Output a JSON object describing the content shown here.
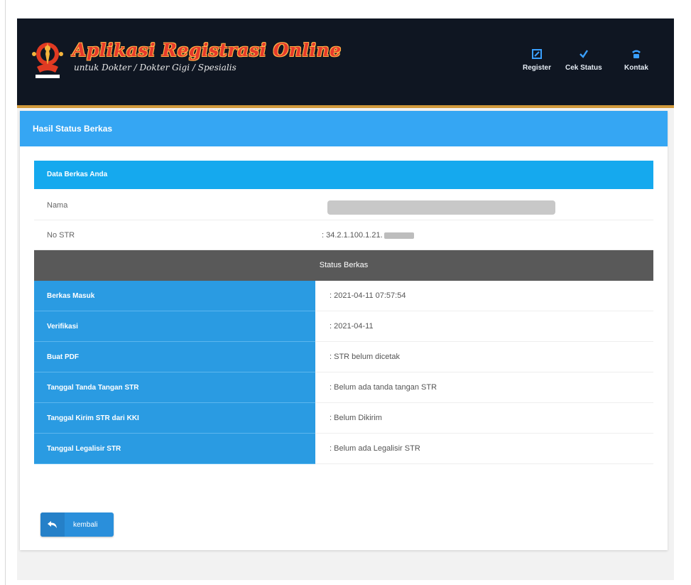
{
  "header": {
    "title": "Aplikasi Registrasi Online",
    "subtitle": "untuk Dokter / Dokter Gigi / Spesialis",
    "nav": [
      {
        "label": "Register",
        "icon": "edit-icon"
      },
      {
        "label": "Cek Status",
        "icon": "check-icon"
      },
      {
        "label": "Kontak",
        "icon": "phone-icon"
      }
    ]
  },
  "card": {
    "title": "Hasil Status Berkas",
    "data_section_title": "Data Berkas Anda",
    "fields": [
      {
        "label": "Nama",
        "value": ""
      },
      {
        "label": "No STR",
        "value": ": 34.2.1.100.1.21."
      }
    ],
    "status_section_title": "Status Berkas",
    "status_rows": [
      {
        "label": "Berkas Masuk",
        "value": ": 2021-04-11 07:57:54"
      },
      {
        "label": "Verifikasi",
        "value": ": 2021-04-11"
      },
      {
        "label": "Buat PDF",
        "value": ": STR belum dicetak"
      },
      {
        "label": "Tanggal Tanda Tangan STR",
        "value": ": Belum ada tanda tangan STR"
      },
      {
        "label": "Tanggal Kirim STR dari KKI",
        "value": ": Belum Dikirim"
      },
      {
        "label": "Tanggal Legalisir STR",
        "value": ": Belum ada Legalisir STR"
      }
    ]
  },
  "back_button": {
    "label": "kembali",
    "icon": "reply-arrow-icon"
  },
  "colors": {
    "header_bg": "#0f1622",
    "accent_blue": "#35a6f3",
    "status_label_bg": "#2a9be2",
    "status_header_bg": "#595959",
    "header_border": "#d19a3c"
  }
}
